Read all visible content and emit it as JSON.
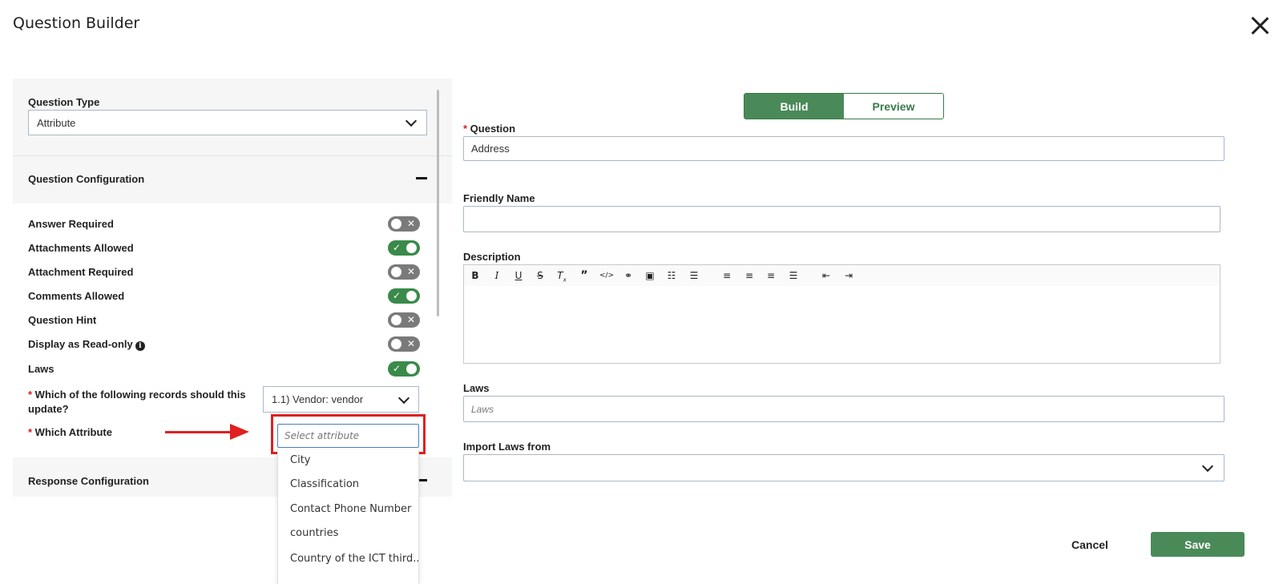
{
  "window": {
    "title": "Question Builder"
  },
  "question_type": {
    "label": "Question Type",
    "value": "Attribute"
  },
  "config": {
    "title": "Question Configuration",
    "toggles": [
      {
        "label": "Answer Required",
        "on": false
      },
      {
        "label": "Attachments Allowed",
        "on": true
      },
      {
        "label": "Attachment Required",
        "on": false
      },
      {
        "label": "Comments Allowed",
        "on": true
      },
      {
        "label": "Question Hint",
        "on": false
      },
      {
        "label": "Display as Read-only",
        "on": false
      },
      {
        "label": "Laws",
        "on": true
      }
    ],
    "records_label": "Which of the following records should this update?",
    "records_value": "1.1) Vendor: vendor",
    "attribute_label": "Which Attribute",
    "attribute_placeholder": "Select attribute",
    "attribute_options": [
      "City",
      "Classification",
      "Contact Phone Number",
      "countries",
      "Country of the ICT third..."
    ]
  },
  "response": {
    "title": "Response Configuration"
  },
  "mode": {
    "build": "Build",
    "preview": "Preview",
    "active": "build"
  },
  "form": {
    "question_label": "Question",
    "question_value": "Address",
    "friendly_label": "Friendly Name",
    "friendly_value": "",
    "description_label": "Description",
    "laws_label": "Laws",
    "laws_placeholder": "Laws",
    "import_label": "Import Laws from",
    "import_value": ""
  },
  "footer": {
    "cancel": "Cancel",
    "save": "Save"
  },
  "colors": {
    "accent": "#4a8a58",
    "highlight": "#e02020",
    "required": "#d32020"
  }
}
